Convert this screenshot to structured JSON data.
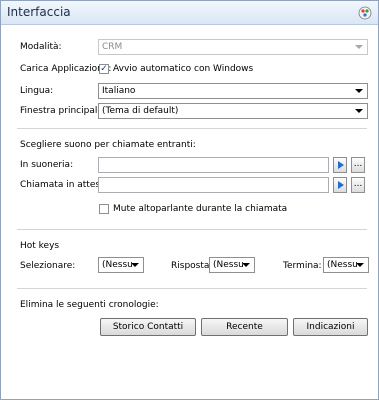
{
  "window": {
    "title": "Interfaccia",
    "icon": "palette-icon"
  },
  "fields": {
    "modalita": {
      "label": "Modalità:",
      "value": "CRM",
      "disabled": true
    },
    "carica": {
      "label": "Carica Applicazione:",
      "checkbox_label": "Avvio automatico con Windows",
      "checked": true
    },
    "lingua": {
      "label": "Lingua:",
      "value": "Italiano"
    },
    "finestra": {
      "label": "Finestra principale:",
      "value": "(Tema di default)"
    }
  },
  "sound": {
    "heading": "Scegliere suono per chiamate entranti:",
    "ringing_label": "In suoneria:",
    "ringing_value": "",
    "waiting_label": "Chiamata in attesa:",
    "waiting_value": "",
    "browse_label": "...",
    "mute_label": "Mute altoparlante durante la chiamata",
    "mute_checked": false
  },
  "hotkeys": {
    "heading": "Hot keys",
    "select_label": "Selezionare:",
    "select_value": "(Nessu",
    "answer_label": "Risposta:",
    "answer_value": "(Nessu",
    "end_label": "Termina:",
    "end_value": "(Nessu"
  },
  "history": {
    "heading": "Elimina le seguenti cronologie:",
    "buttons": [
      "Storico Contatti",
      "Recente",
      "Indicazioni"
    ]
  },
  "colors": {
    "play_arrow": "#1f6fcf",
    "separator": "#d4d4d4"
  }
}
